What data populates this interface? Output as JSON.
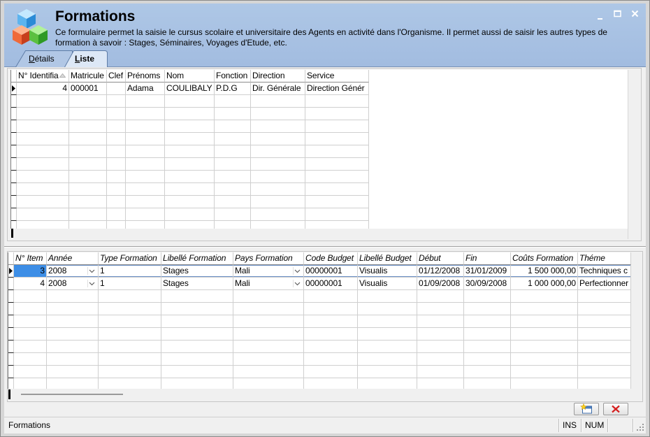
{
  "window": {
    "title": "Formations",
    "description": "Ce formulaire permet la saisie le cursus scolaire et universitaire des Agents en activité dans l'Organisme. Il permet aussi de saisir les autres types de formation à savoir : Stages, Séminaires, Voyages d'Etude, etc.",
    "icons": {
      "app": "cubes-icon",
      "minimize": "minimize-icon",
      "maximize": "maximize-icon",
      "close": "close-icon"
    }
  },
  "colors": {
    "header": "#a6bfe0",
    "active_tab": "#dde8f6",
    "selection": "#3d8ee6"
  },
  "tabs": [
    {
      "label": "Détails",
      "active": false
    },
    {
      "label": "Liste",
      "active": true
    }
  ],
  "agents_grid": {
    "columns": [
      "N° Identifia",
      "Matricule",
      "Clef",
      "Prénoms",
      "Nom",
      "Fonction",
      "Direction",
      "Service"
    ],
    "rows": [
      [
        "4",
        "000001",
        "",
        "Adama",
        "COULIBALY",
        "P.D.G",
        "Dir. Générale",
        "Direction Génér"
      ]
    ],
    "sort_column_index": 0,
    "current_row": 0
  },
  "formations_grid": {
    "columns": [
      "N° Item",
      "Année",
      "Type Formation",
      "Libellé Formation",
      "Pays Formation",
      "Code Budget",
      "Libellé Budget",
      "Début",
      "Fin",
      "Coûts Formation",
      "Théme"
    ],
    "rows": [
      [
        "3",
        "2008",
        "1",
        "Stages",
        "Mali",
        "00000001",
        "Visualis",
        "01/12/2008",
        "31/01/2009",
        "1 500 000,00",
        "Techniques c"
      ],
      [
        "4",
        "2008",
        "1",
        "Stages",
        "Mali",
        "00000001",
        "Visualis",
        "01/09/2008",
        "30/09/2008",
        "1 000 000,00",
        "Perfectionner"
      ]
    ],
    "dropdown_column_indexes": [
      1,
      4
    ],
    "current_row": 0,
    "selected_cell_index": 0
  },
  "toolbar": {
    "new_icon": "new-record-icon",
    "delete_icon": "delete-icon"
  },
  "status_bar": {
    "label": "Formations",
    "ins": "INS",
    "num": "NUM"
  }
}
